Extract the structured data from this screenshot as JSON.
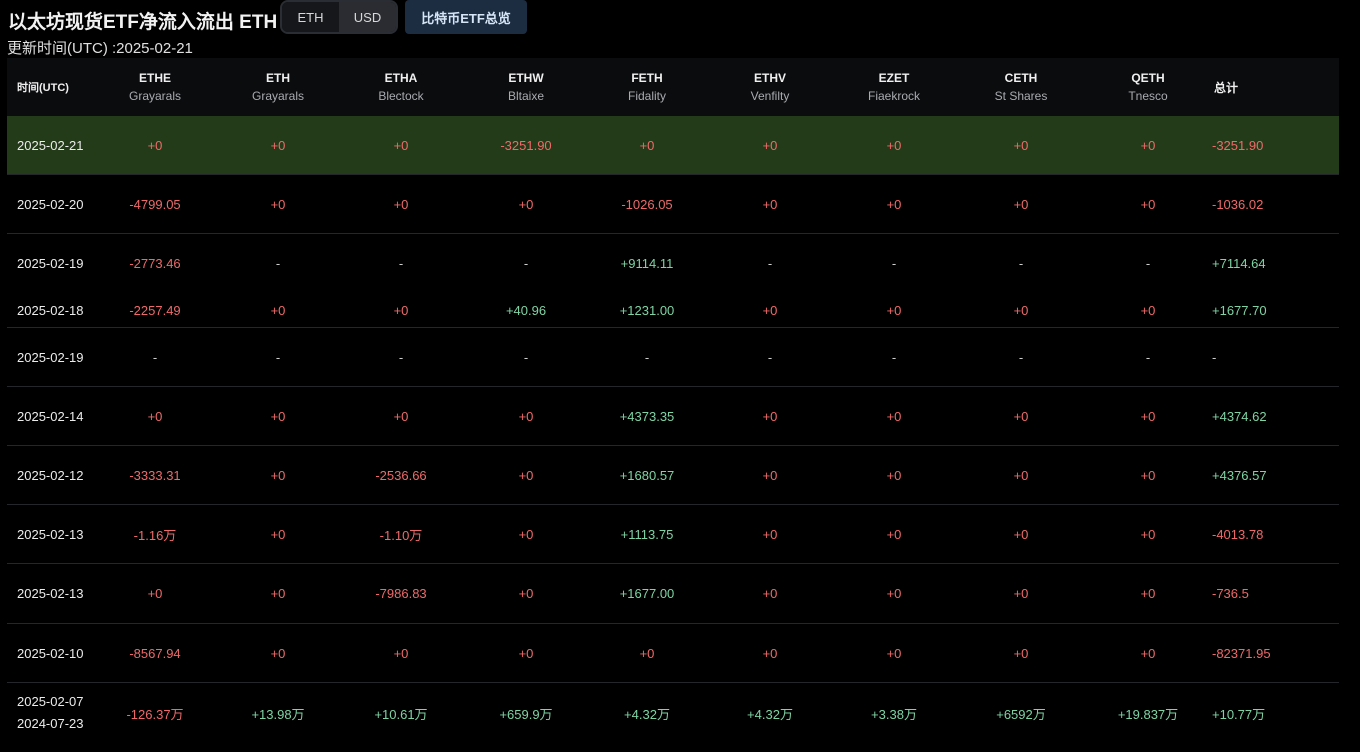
{
  "header": {
    "title": "以太坊现货ETF净流入流出 ETH",
    "toggle": {
      "eth_label": "ETH",
      "usd_label": "USD"
    },
    "overview_button": "比特币ETF总览",
    "updated": "更新时间(UTC) :2025-02-21"
  },
  "colors": {
    "negative": "#ee6a6a",
    "positive": "#7fd3a4",
    "highlight_row": "#233b18",
    "button_bg": "#1c2d42"
  },
  "table": {
    "date_header": "时间(UTC)",
    "total_header": "总计",
    "columns": [
      {
        "ticker": "ETHE",
        "issuer": "Grayarals"
      },
      {
        "ticker": "ETH",
        "issuer": "Grayarals"
      },
      {
        "ticker": "ETHA",
        "issuer": "Blectock"
      },
      {
        "ticker": "ETHW",
        "issuer": "Bltaixe"
      },
      {
        "ticker": "FETH",
        "issuer": "Fidality"
      },
      {
        "ticker": "ETHV",
        "issuer": "Venfilty"
      },
      {
        "ticker": "EZET",
        "issuer": "Fiaekrock"
      },
      {
        "ticker": "CETH",
        "issuer": "St Shares"
      },
      {
        "ticker": "QETH",
        "issuer": "Tnesco"
      }
    ],
    "rows": [
      {
        "date": "2025-02-21",
        "values": [
          "+0",
          "+0",
          "+0",
          "-3251.90",
          "+0",
          "+0",
          "+0",
          "+0",
          "+0"
        ],
        "total": "-3251.90"
      },
      {
        "date": "2025-02-20",
        "values": [
          "-4799.05",
          "+0",
          "+0",
          "+0",
          "-1026.05",
          "+0",
          "+0",
          "+0",
          "+0"
        ],
        "total": "-1036.02"
      },
      {
        "date": "2025-02-19",
        "values": [
          "-2773.46",
          "-",
          "-",
          "-",
          "+9114.11",
          "-",
          "-",
          "-",
          "-"
        ],
        "total": "+7114.64"
      },
      {
        "date": "2025-02-18",
        "values": [
          "-2257.49",
          "+0",
          "+0",
          "+40.96",
          "+1231.00",
          "+0",
          "+0",
          "+0",
          "+0"
        ],
        "total": "+1677.70"
      },
      {
        "date": "2025-02-19",
        "values": [
          "-",
          "-",
          "-",
          "-",
          "-",
          "-",
          "-",
          "-",
          "-"
        ],
        "total": "-"
      },
      {
        "date": "2025-02-14",
        "values": [
          "+0",
          "+0",
          "+0",
          "+0",
          "+4373.35",
          "+0",
          "+0",
          "+0",
          "+0"
        ],
        "total": "+4374.62"
      },
      {
        "date": "2025-02-12",
        "values": [
          "-3333.31",
          "+0",
          "-2536.66",
          "+0",
          "+1680.57",
          "+0",
          "+0",
          "+0",
          "+0"
        ],
        "total": "+4376.57"
      },
      {
        "date": "2025-02-13",
        "values": [
          "-1.16万",
          "+0",
          "-1.10万",
          "+0",
          "+1113.75",
          "+0",
          "+0",
          "+0",
          "+0"
        ],
        "total": "-4013.78"
      },
      {
        "date": "2025-02-13",
        "values": [
          "+0",
          "+0",
          "-7986.83",
          "+0",
          "+1677.00",
          "+0",
          "+0",
          "+0",
          "+0"
        ],
        "total": "-736.5"
      },
      {
        "date": "2025-02-10",
        "values": [
          "-8567.94",
          "+0",
          "+0",
          "+0",
          "+0",
          "+0",
          "+0",
          "+0",
          "+0"
        ],
        "total": "-82371.95"
      }
    ],
    "summary": {
      "date_line1": "2025-02-07",
      "date_line2": "2024-07-23",
      "values": [
        "-126.37万",
        "+13.98万",
        "+10.61万",
        "+659.9万",
        "+4.32万",
        "+4.32万",
        "+3.38万",
        "+6592万",
        "+19.837万"
      ],
      "total": "+10.77万"
    }
  }
}
